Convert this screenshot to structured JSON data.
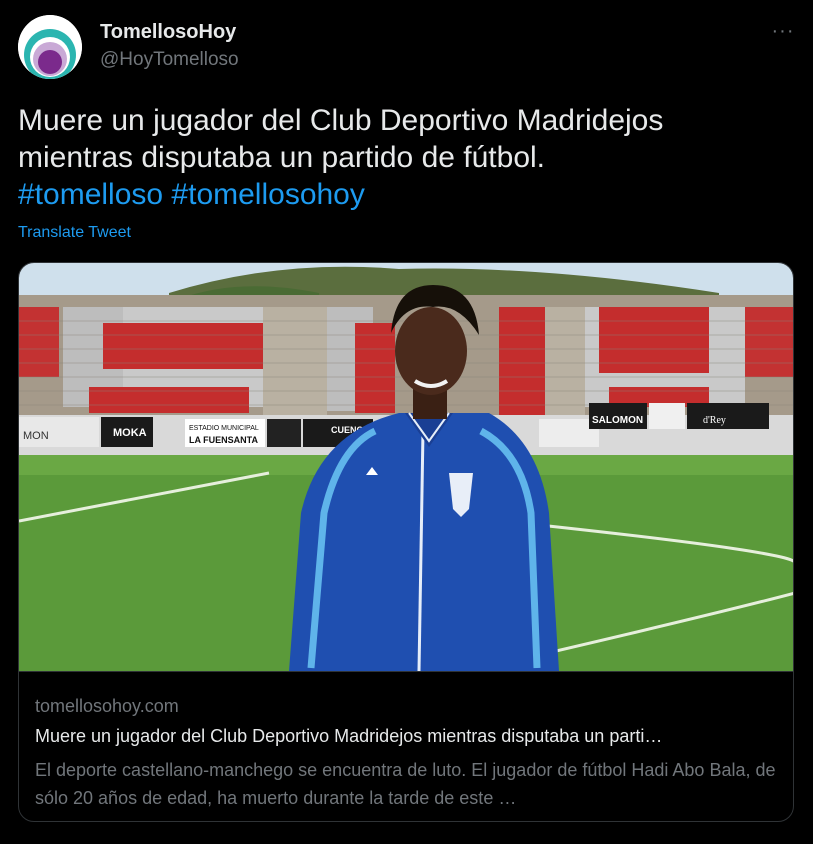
{
  "author": {
    "name": "TomellosoHoy",
    "handle": "@HoyTomelloso"
  },
  "tweet": {
    "text": "Muere un jugador del Club Deportivo Madridejos mientras disputaba un partido de fútbol.",
    "hashtags": [
      "#tomelloso",
      "#tomellosohoy"
    ],
    "translate_label": "Translate Tweet"
  },
  "card": {
    "domain": "tomellosohoy.com",
    "title": "Muere un jugador del Club Deportivo Madridejos mientras disputaba un parti…",
    "description": "El deporte castellano-manchego se encuentra de luto. El jugador de fútbol Hadi Abo Bala, de sólo 20 años de edad, ha muerto durante la tarde de este …",
    "image_signs": {
      "moka": "MOKA",
      "estadio_line1": "ESTADIO MUNICIPAL",
      "estadio_line2": "LA FUENSANTA",
      "cuenca": "CUENCA",
      "salomon": "SALOMON",
      "rey": "d'Rey",
      "mon": "MON"
    }
  },
  "colors": {
    "background": "#000000",
    "text": "#e7e9ea",
    "secondary": "#71767b",
    "link": "#1d9bf0",
    "border": "#2f3336",
    "avatar_purple": "#7b2a8c",
    "avatar_teal": "#2bb5b0"
  }
}
